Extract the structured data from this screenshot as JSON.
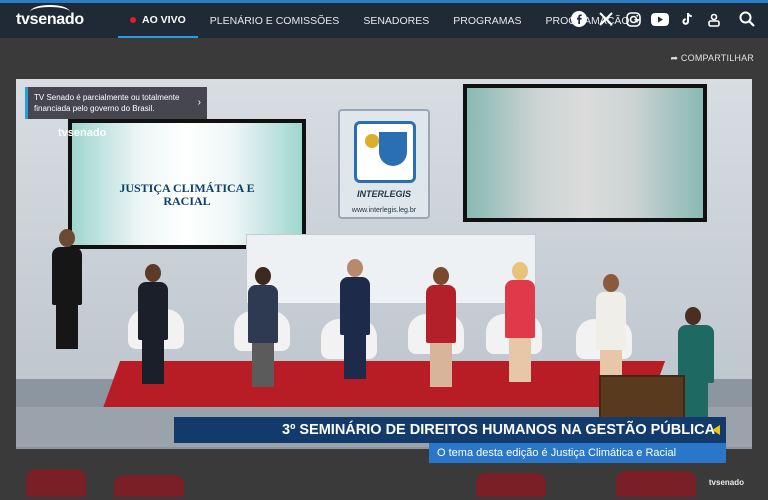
{
  "brand": {
    "logo": "tvsenado"
  },
  "nav": {
    "items": [
      {
        "label": "AO VIVO",
        "active": true
      },
      {
        "label": "PLENÁRIO E COMISSÕES"
      },
      {
        "label": "SENADORES"
      },
      {
        "label": "PROGRAMAS"
      },
      {
        "label": "PROGRAMAÇÃO",
        "dropdown": true
      }
    ]
  },
  "social": [
    "facebook-icon",
    "x-icon",
    "instagram-icon",
    "youtube-icon",
    "tiktok-icon",
    "podcast-icon"
  ],
  "share_label": "COMPARTILHAR",
  "video": {
    "notice": "TV Senado é parcialmente ou totalmente financiada pelo governo do Brasil.",
    "watermark": "tvsenado",
    "screen_title": "JUSTIÇA CLIMÁTICA E RACIAL",
    "wall_logo": "INTERLEGIS",
    "wall_url": "www.interlegis.leg.br",
    "lower_third_title": "3º SEMINÁRIO DE DIREITOS HUMANOS NA GESTÃO PÚBLICA",
    "lower_third_subtitle": "O tema desta edição é Justiça Climática e Racial",
    "corner_watermark": "tvsenado"
  },
  "colors": {
    "topbar": "#1f2a36",
    "accent": "#2b9be0",
    "live": "#e02020",
    "lower_third": "#123a6a",
    "lower_third_sub": "#2a76c8"
  }
}
